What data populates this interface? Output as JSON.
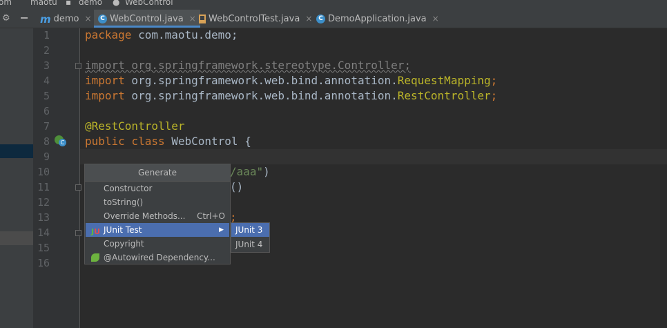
{
  "breadcrumbs": [
    "om",
    "maotu",
    "demo",
    "WebControl"
  ],
  "tabs": [
    {
      "label": "demo",
      "icon": "module-m-icon",
      "active": false
    },
    {
      "label": "WebControl.java",
      "icon": "java-class-icon",
      "active": true
    },
    {
      "label": "WebControlTest.java",
      "icon": "java-test-file-icon",
      "active": false
    },
    {
      "label": "DemoApplication.java",
      "icon": "spring-boot-class-icon",
      "active": false
    }
  ],
  "tab_close": "×",
  "line_numbers": [
    "1",
    "2",
    "3",
    "4",
    "5",
    "6",
    "7",
    "8",
    "9",
    "10",
    "11",
    "12",
    "13",
    "14",
    "15",
    "16"
  ],
  "code": {
    "l1_kw": "package",
    "l1_rest": " com.maotu.demo;",
    "l3": "import org.springframework.stereotype.Controller;",
    "l4_kw": "import",
    "l4_pkg": " org.springframework.web.bind.annotation.",
    "l4_cls": "RequestMapping",
    "l4_end": ";",
    "l5_kw": "import",
    "l5_pkg": " org.springframework.web.bind.annotation.",
    "l5_cls": "RestController",
    "l5_end": ";",
    "l7": "@RestController",
    "l8_kw": "public class",
    "l8_rest": " WebControl {",
    "l10_str": "/aaa\"",
    "l10_end": ")",
    "l11": "()",
    "l13": ";"
  },
  "generate_popup": {
    "title": "Generate",
    "items": [
      {
        "label": "Constructor",
        "shortcut": "",
        "icon": ""
      },
      {
        "label": "toString()",
        "shortcut": "",
        "icon": ""
      },
      {
        "label": "Override Methods...",
        "shortcut": "Ctrl+O",
        "icon": ""
      },
      {
        "label": "JUnit Test",
        "shortcut": "",
        "icon": "junit-icon",
        "highlighted": true,
        "submenu": true
      },
      {
        "label": "Copyright",
        "shortcut": "",
        "icon": ""
      },
      {
        "label": "@Autowired Dependency...",
        "shortcut": "",
        "icon": "spring-leaf-icon"
      }
    ]
  },
  "junit_submenu": {
    "items": [
      {
        "label": "JUnit 3",
        "highlighted": true
      },
      {
        "label": "JUnit 4",
        "highlighted": false
      }
    ]
  },
  "colors": {
    "editor_bg": "#2b2b2b",
    "keyword": "#cc7832",
    "annotation": "#bbb529",
    "string": "#6a8759",
    "selection": "#4b6eaf"
  }
}
